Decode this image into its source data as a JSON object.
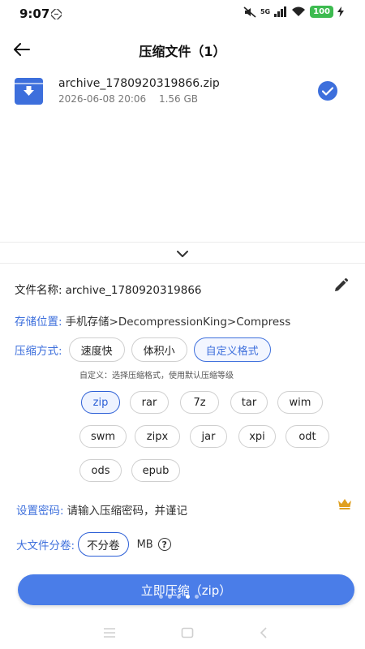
{
  "status_bar": {
    "time": "9:07",
    "network": "5G",
    "battery": "100"
  },
  "app_bar": {
    "title": "压缩文件（1）"
  },
  "file": {
    "name": "archive_1780920319866.zip",
    "date": "2026-06-08 20:06",
    "size": "1.56 GB",
    "selected": true
  },
  "form": {
    "name_label": "文件名称:",
    "name_value": "archive_1780920319866",
    "location_label": "存储位置:",
    "location_value": "手机存储>DecompressionKing>Compress",
    "mode_label": "压缩方式:",
    "modes": [
      "速度快",
      "体积小",
      "自定义格式"
    ],
    "selected_mode": "自定义格式",
    "custom_hint": "自定义：选择压缩格式，使用默认压缩等级",
    "formats": [
      "zip",
      "rar",
      "7z",
      "tar",
      "wim",
      "swm",
      "zipx",
      "jar",
      "xpi",
      "odt",
      "ods",
      "epub"
    ],
    "selected_format": "zip",
    "password_label": "设置密码:",
    "password_placeholder": "请输入压缩密码，并谨记",
    "split_label": "大文件分卷:",
    "split_value": "不分卷",
    "split_unit": "MB",
    "help_glyph": "?"
  },
  "action": {
    "compress_label": "立即压缩（zip）"
  },
  "colors": {
    "accent": "#3d6fdc",
    "button": "#4a7de8",
    "battery": "#3dbb50",
    "crown": "#e0a020"
  },
  "icons": {
    "back": "arrow-left-icon",
    "file": "archive-file-icon",
    "check": "check-circle-icon",
    "collapse": "chevron-down-icon",
    "edit": "pencil-icon",
    "crown": "crown-icon",
    "help": "help-circle-icon"
  }
}
